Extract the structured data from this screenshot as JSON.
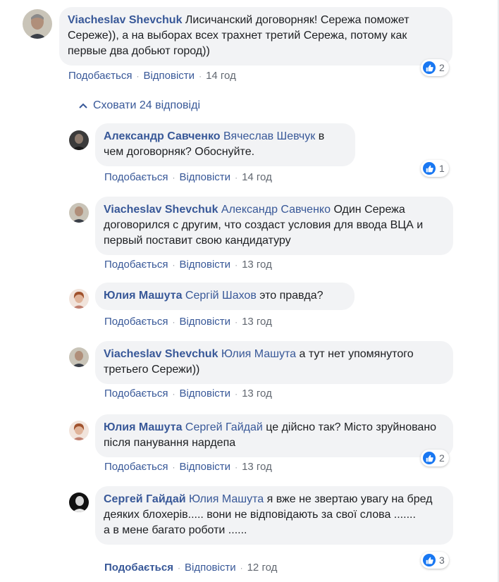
{
  "actions": {
    "like": "Подобається",
    "reply": "Відповісти"
  },
  "hide_replies": "Сховати 24 відповіді",
  "comments": [
    {
      "author": "Viacheslav Shevchuk",
      "mention": "",
      "text": "Лисичанский договорняк! Сережа поможет Сереже)), а на выборах всех трахнет третий Сережа, потому как первые два добьют город))",
      "time": "14 год",
      "reactions": "2"
    },
    {
      "author": "Александр Савченко",
      "mention": "Вячеслав Шевчук",
      "text": "в чем договорняк? Обоснуйте.",
      "time": "14 год",
      "reactions": "1"
    },
    {
      "author": "Viacheslav Shevchuk",
      "mention": "Александр Савченко",
      "text": "Один Сережа договорился с другим, что создаст условия для ввода ВЦА и первый поставит свою кандидатуру",
      "time": "13 год",
      "reactions": ""
    },
    {
      "author": "Юлия Машута",
      "mention": "Сергій Шахов",
      "text": "это правда?",
      "time": "13 год",
      "reactions": ""
    },
    {
      "author": "Viacheslav Shevchuk",
      "mention": "Юлия Машута",
      "text": "а тут нет упомянутого третьего Сережи))",
      "time": "13 год",
      "reactions": ""
    },
    {
      "author": "Юлия Машута",
      "mention": "Сергей Гайдай",
      "text": "це дійсно так? Місто зруйновано після панування нардепа",
      "time": "13 год",
      "reactions": "2"
    },
    {
      "author": "Сергей Гайдай",
      "mention": "Юлия Машута",
      "text": "я вже не звертаю увагу на бред деяких блохерів..... вони не відповідають за свої слова .......",
      "text2": "а в мене багато роботи ......",
      "time": "12 год",
      "reactions": "3"
    }
  ],
  "colors": {
    "link": "#385898",
    "bubble": "#f2f3f5",
    "meta": "#616770",
    "like_blue": "#1877f2"
  },
  "icons": {
    "like": "thumbs-up-icon",
    "chevron": "chevron-up-icon"
  }
}
